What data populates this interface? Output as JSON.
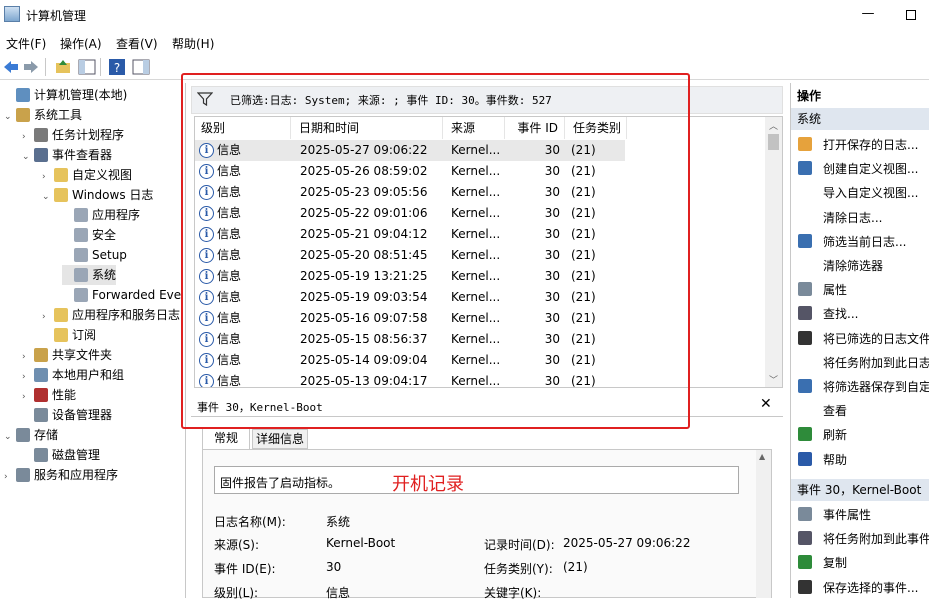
{
  "window": {
    "title": "计算机管理",
    "minimize": "—"
  },
  "menu": [
    "文件(F)",
    "操作(A)",
    "查看(V)",
    "帮助(H)"
  ],
  "tree": [
    {
      "label": "计算机管理(本地)",
      "x": 4,
      "exp": "",
      "color": "#5f8fbf"
    },
    {
      "label": "系统工具",
      "x": 4,
      "exp": "⌄",
      "color": "#c9a24b"
    },
    {
      "label": "任务计划程序",
      "x": 22,
      "exp": "›",
      "color": "#7a7a7a"
    },
    {
      "label": "事件查看器",
      "x": 22,
      "exp": "⌄",
      "color": "#5a6f8f"
    },
    {
      "label": "自定义视图",
      "x": 42,
      "exp": "›",
      "color": "#e6c35c"
    },
    {
      "label": "Windows 日志",
      "x": 42,
      "exp": "⌄",
      "color": "#e6c35c"
    },
    {
      "label": "应用程序",
      "x": 62,
      "exp": "",
      "color": "#9aa6b6"
    },
    {
      "label": "安全",
      "x": 62,
      "exp": "",
      "color": "#9aa6b6"
    },
    {
      "label": "Setup",
      "x": 62,
      "exp": "",
      "color": "#9aa6b6"
    },
    {
      "label": "系统",
      "x": 62,
      "exp": "",
      "color": "#9aa6b6"
    },
    {
      "label": "Forwarded Eve",
      "x": 62,
      "exp": "",
      "color": "#9aa6b6"
    },
    {
      "label": "应用程序和服务日志",
      "x": 42,
      "exp": "›",
      "color": "#e6c35c"
    },
    {
      "label": "订阅",
      "x": 42,
      "exp": "",
      "color": "#e6c35c"
    },
    {
      "label": "共享文件夹",
      "x": 22,
      "exp": "›",
      "color": "#c9a24b"
    },
    {
      "label": "本地用户和组",
      "x": 22,
      "exp": "›",
      "color": "#6f8fb0"
    },
    {
      "label": "性能",
      "x": 22,
      "exp": "›",
      "color": "#b03030"
    },
    {
      "label": "设备管理器",
      "x": 22,
      "exp": "",
      "color": "#7a8a9a"
    },
    {
      "label": "存储",
      "x": 4,
      "exp": "⌄",
      "color": "#7a8a9a"
    },
    {
      "label": "磁盘管理",
      "x": 22,
      "exp": "",
      "color": "#7a8a9a"
    },
    {
      "label": "服务和应用程序",
      "x": 4,
      "exp": "›",
      "color": "#7a8a9a"
    }
  ],
  "filter": {
    "text": "已筛选:日志: System; 来源: ; 事件 ID: 30。事件数: 527"
  },
  "list": {
    "headers": [
      "级别",
      "日期和时间",
      "来源",
      "事件 ID",
      "任务类别"
    ],
    "rows": [
      {
        "level": "信息",
        "date": "2025-05-27 09:06:22",
        "source": "Kernel...",
        "id": "30",
        "cat": "(21)"
      },
      {
        "level": "信息",
        "date": "2025-05-26 08:59:02",
        "source": "Kernel...",
        "id": "30",
        "cat": "(21)"
      },
      {
        "level": "信息",
        "date": "2025-05-23 09:05:56",
        "source": "Kernel...",
        "id": "30",
        "cat": "(21)"
      },
      {
        "level": "信息",
        "date": "2025-05-22 09:01:06",
        "source": "Kernel...",
        "id": "30",
        "cat": "(21)"
      },
      {
        "level": "信息",
        "date": "2025-05-21 09:04:12",
        "source": "Kernel...",
        "id": "30",
        "cat": "(21)"
      },
      {
        "level": "信息",
        "date": "2025-05-20 08:51:45",
        "source": "Kernel...",
        "id": "30",
        "cat": "(21)"
      },
      {
        "level": "信息",
        "date": "2025-05-19 13:21:25",
        "source": "Kernel...",
        "id": "30",
        "cat": "(21)"
      },
      {
        "level": "信息",
        "date": "2025-05-19 09:03:54",
        "source": "Kernel...",
        "id": "30",
        "cat": "(21)"
      },
      {
        "level": "信息",
        "date": "2025-05-16 09:07:58",
        "source": "Kernel...",
        "id": "30",
        "cat": "(21)"
      },
      {
        "level": "信息",
        "date": "2025-05-15 08:56:37",
        "source": "Kernel...",
        "id": "30",
        "cat": "(21)"
      },
      {
        "level": "信息",
        "date": "2025-05-14 09:09:04",
        "source": "Kernel...",
        "id": "30",
        "cat": "(21)"
      },
      {
        "level": "信息",
        "date": "2025-05-13 09:04:17",
        "source": "Kernel...",
        "id": "30",
        "cat": "(21)"
      }
    ]
  },
  "detail": {
    "title": "事件 30，Kernel-Boot",
    "tabs": [
      "常规",
      "详细信息"
    ],
    "description": "固件报告了启动指标。",
    "annotation": "开机记录",
    "fields": {
      "log_name_label": "日志名称(M):",
      "log_name": "系统",
      "source_label": "来源(S):",
      "source": "Kernel-Boot",
      "logged_label": "记录时间(D):",
      "logged": "2025-05-27 09:06:22",
      "event_id_label": "事件 ID(E):",
      "event_id": "30",
      "task_label": "任务类别(Y):",
      "task": "(21)",
      "level_label": "级别(L):",
      "level": "信息",
      "keywords_label": "关键字(K):"
    }
  },
  "actions": {
    "header": "操作",
    "section1": "系统",
    "items1": [
      "打开保存的日志...",
      "创建自定义视图...",
      "导入自定义视图...",
      "清除日志...",
      "筛选当前日志...",
      "清除筛选器",
      "属性",
      "查找...",
      "将已筛选的日志文件",
      "将任务附加到此日志",
      "将筛选器保存到自定",
      "查看",
      "刷新",
      "帮助"
    ],
    "section2": "事件 30，Kernel-Boot",
    "items2": [
      "事件属性",
      "将任务附加到此事件",
      "复制",
      "保存选择的事件..."
    ]
  },
  "colors": {
    "highlight_box": "#e02020",
    "info_icon": "#2a5aa8"
  }
}
